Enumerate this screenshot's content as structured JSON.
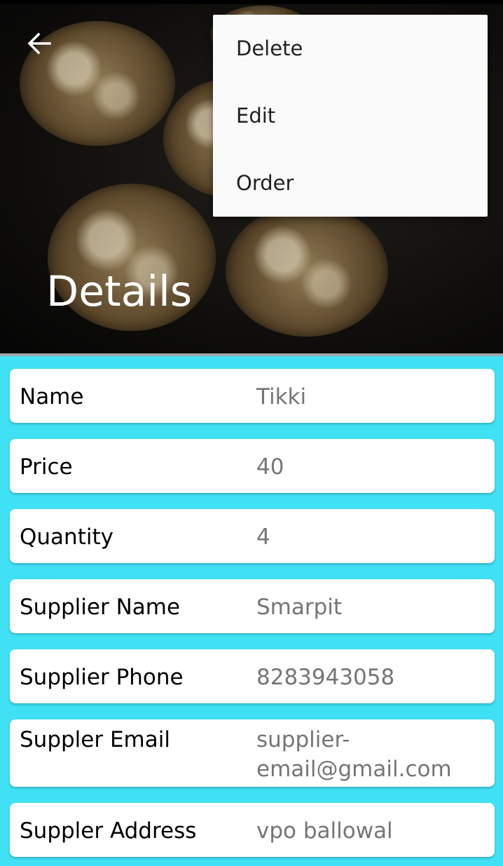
{
  "header": {
    "title": "Details",
    "back_icon": "arrow-back-icon"
  },
  "menu": {
    "items": [
      {
        "label": "Delete"
      },
      {
        "label": "Edit"
      },
      {
        "label": "Order"
      }
    ]
  },
  "details": {
    "rows": [
      {
        "label": "Name",
        "value": "Tikki"
      },
      {
        "label": "Price",
        "value": "40"
      },
      {
        "label": "Quantity",
        "value": "4"
      },
      {
        "label": "Supplier Name",
        "value": "Smarpit"
      },
      {
        "label": "Supplier Phone",
        "value": "8283943058"
      },
      {
        "label": "Suppler Email",
        "value": "supplier-\nemail@gmail.com"
      },
      {
        "label": "Suppler Address",
        "value": "vpo ballowal"
      }
    ]
  },
  "colors": {
    "background": "#40E0F5",
    "card": "#FFFFFF",
    "label_text": "#000000",
    "value_text": "#757575",
    "menu_background": "#FAFAFA"
  }
}
